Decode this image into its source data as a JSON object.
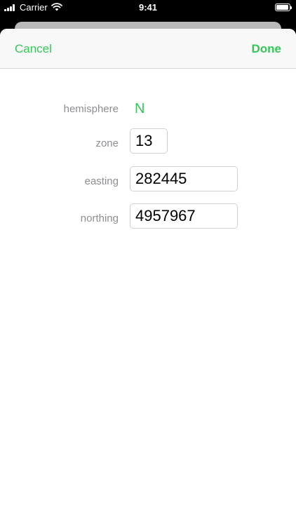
{
  "status_bar": {
    "carrier": "Carrier",
    "time": "9:41",
    "signal_icon": "cellular-signal-icon",
    "wifi_icon": "wifi-icon",
    "battery_icon": "battery-icon",
    "battery_level": 1.0
  },
  "nav": {
    "cancel_label": "Cancel",
    "done_label": "Done"
  },
  "form": {
    "hemisphere": {
      "label": "hemisphere",
      "value": "N"
    },
    "zone": {
      "label": "zone",
      "value": "13"
    },
    "easting": {
      "label": "easting",
      "value": "282445"
    },
    "northing": {
      "label": "northing",
      "value": "4957967"
    }
  },
  "colors": {
    "accent": "#34c759",
    "label": "#8e8e93",
    "background": "#ffffff"
  }
}
